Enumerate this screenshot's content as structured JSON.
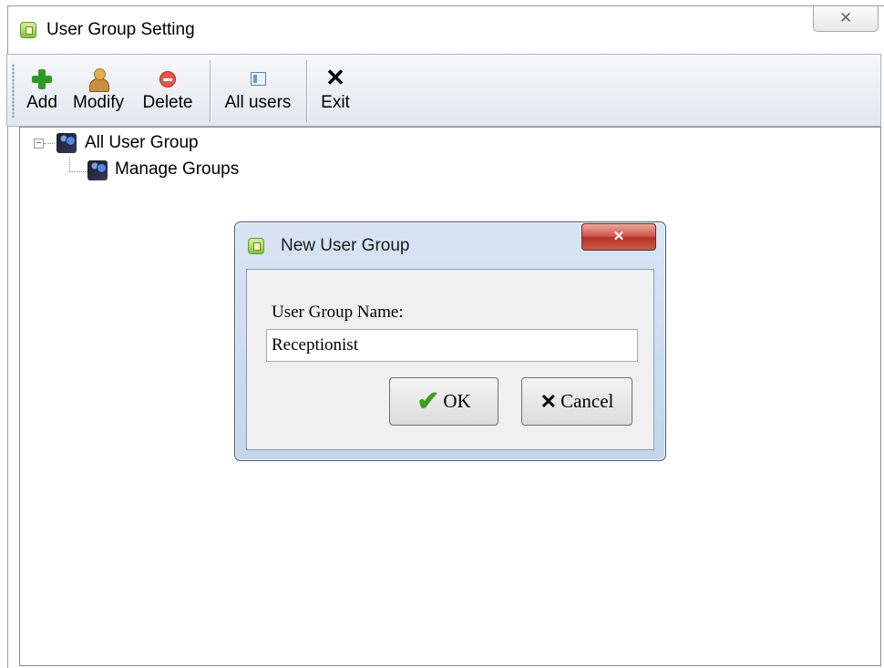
{
  "window": {
    "title": "User Group Setting",
    "close_glyph": "✕"
  },
  "toolbar": {
    "buttons": [
      {
        "label": "Add",
        "icon": "plus-icon"
      },
      {
        "label": "Modify",
        "icon": "users-icon"
      },
      {
        "label": "Delete",
        "icon": "minus-circle-icon"
      },
      {
        "label": "All users",
        "icon": "list-icon"
      },
      {
        "label": "Exit",
        "icon": "close-icon"
      }
    ],
    "exit_glyph": "✕"
  },
  "tree": {
    "toggle": "−",
    "root_label": "All User Group",
    "child_label": "Manage Groups"
  },
  "dialog": {
    "title": "New User Group",
    "close_glyph": "✕",
    "field_label": "User Group Name:",
    "field_value": "Receptionist",
    "ok_label": "OK",
    "ok_glyph": "✔",
    "cancel_label": "Cancel",
    "cancel_glyph": "✕"
  }
}
